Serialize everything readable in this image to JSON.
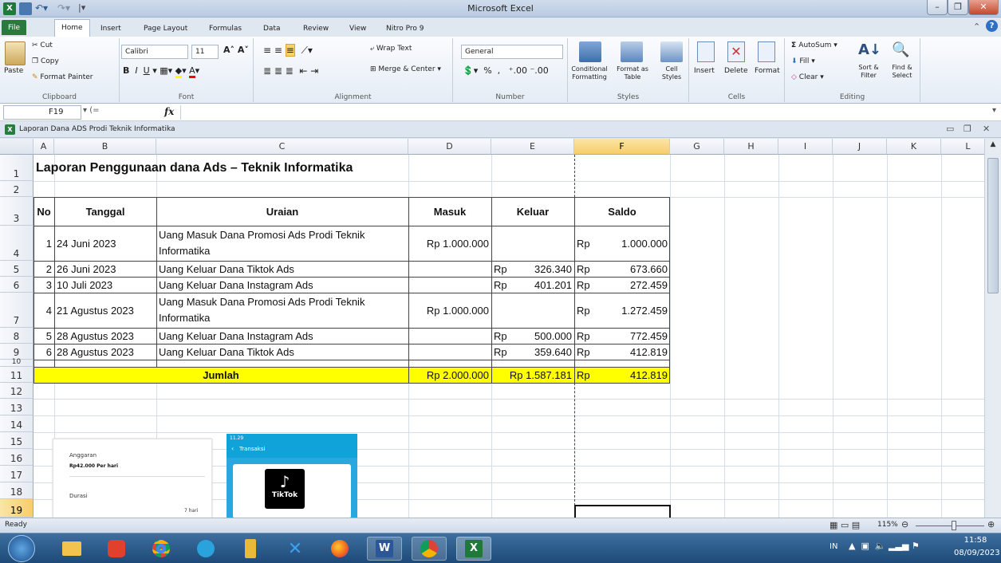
{
  "window": {
    "title": "Microsoft Excel"
  },
  "tabs": [
    "File",
    "Home",
    "Insert",
    "Page Layout",
    "Formulas",
    "Data",
    "Review",
    "View",
    "Nitro Pro 9"
  ],
  "ribbon": {
    "clipboard": {
      "paste": "Paste",
      "cut": "Cut",
      "copy": "Copy",
      "format_painter": "Format Painter",
      "label": "Clipboard"
    },
    "font": {
      "name": "Calibri",
      "size": "11",
      "label": "Font"
    },
    "alignment": {
      "wrap": "Wrap Text",
      "merge": "Merge & Center",
      "label": "Alignment"
    },
    "number": {
      "format": "General",
      "label": "Number"
    },
    "styles": {
      "conditional": "Conditional Formatting",
      "format_table": "Format as Table",
      "cell_styles": "Cell Styles",
      "label": "Styles"
    },
    "cells": {
      "insert": "Insert",
      "delete": "Delete",
      "format": "Format",
      "label": "Cells"
    },
    "editing": {
      "autosum": "AutoSum",
      "fill": "Fill",
      "clear": "Clear",
      "sort": "Sort & Filter",
      "find": "Find & Select",
      "label": "Editing"
    }
  },
  "formula_bar": {
    "name_box": "F19",
    "fx": "fx",
    "formula": ""
  },
  "workbook": {
    "title": "Laporan Dana ADS Prodi Teknik Informatika"
  },
  "columns": [
    "A",
    "B",
    "C",
    "D",
    "E",
    "F",
    "G",
    "H",
    "I",
    "J",
    "K",
    "L"
  ],
  "selected_col": "F",
  "selected_row": "19",
  "rows": [
    "1",
    "2",
    "3",
    "4",
    "5",
    "6",
    "7",
    "8",
    "9",
    "10",
    "11",
    "12",
    "13",
    "14",
    "15",
    "16",
    "17",
    "18",
    "19"
  ],
  "sheet": {
    "title": "Laporan Penggunaan dana Ads – Teknik Informatika",
    "headers": {
      "no": "No",
      "tanggal": "Tanggal",
      "uraian": "Uraian",
      "masuk": "Masuk",
      "keluar": "Keluar",
      "saldo": "Saldo"
    },
    "rp": "Rp",
    "records": [
      {
        "no": "1",
        "tanggal": "24 Juni 2023",
        "uraian1": "Uang Masuk Dana Promosi Ads Prodi Teknik",
        "uraian2": "Informatika",
        "masuk": "Rp 1.000.000",
        "keluar": "",
        "saldo": "1.000.000"
      },
      {
        "no": "2",
        "tanggal": "26 Juni 2023",
        "uraian1": "Uang Keluar Dana Tiktok Ads",
        "uraian2": "",
        "masuk": "",
        "keluar": "326.340",
        "saldo": "673.660"
      },
      {
        "no": "3",
        "tanggal": "10 Juli 2023",
        "uraian1": "Uang Keluar Dana Instagram Ads",
        "uraian2": "",
        "masuk": "",
        "keluar": "401.201",
        "saldo": "272.459"
      },
      {
        "no": "4",
        "tanggal": "21 Agustus 2023",
        "uraian1": "Uang Masuk Dana Promosi Ads Prodi Teknik",
        "uraian2": "Informatika",
        "masuk": "Rp 1.000.000",
        "keluar": "",
        "saldo": "1.272.459"
      },
      {
        "no": "5",
        "tanggal": "28 Agustus 2023",
        "uraian1": "Uang Keluar Dana Instagram Ads",
        "uraian2": "",
        "masuk": "",
        "keluar": "500.000",
        "saldo": "772.459"
      },
      {
        "no": "6",
        "tanggal": "28 Agustus 2023",
        "uraian1": "Uang Keluar Dana Tiktok Ads",
        "uraian2": "",
        "masuk": "",
        "keluar": "359.640",
        "saldo": "412.819"
      }
    ],
    "total": {
      "label": "Jumlah",
      "masuk": "Rp 2.000.000",
      "keluar": "Rp 1.587.181",
      "saldo": "412.819"
    },
    "highlight_color": "#ffff00"
  },
  "images": {
    "ad_budget": {
      "anggaran": "Anggaran",
      "per_day": "Rp42.000 Per hari",
      "durasi": "Durasi",
      "days": "7 hari"
    },
    "phone": {
      "time": "11.29",
      "header": "Transaksi",
      "brand": "TikTok"
    }
  },
  "status": {
    "ready": "Ready",
    "zoom": "115%"
  },
  "taskbar": {
    "lang": "IN",
    "time": "11:58",
    "date": "08/09/2023"
  }
}
